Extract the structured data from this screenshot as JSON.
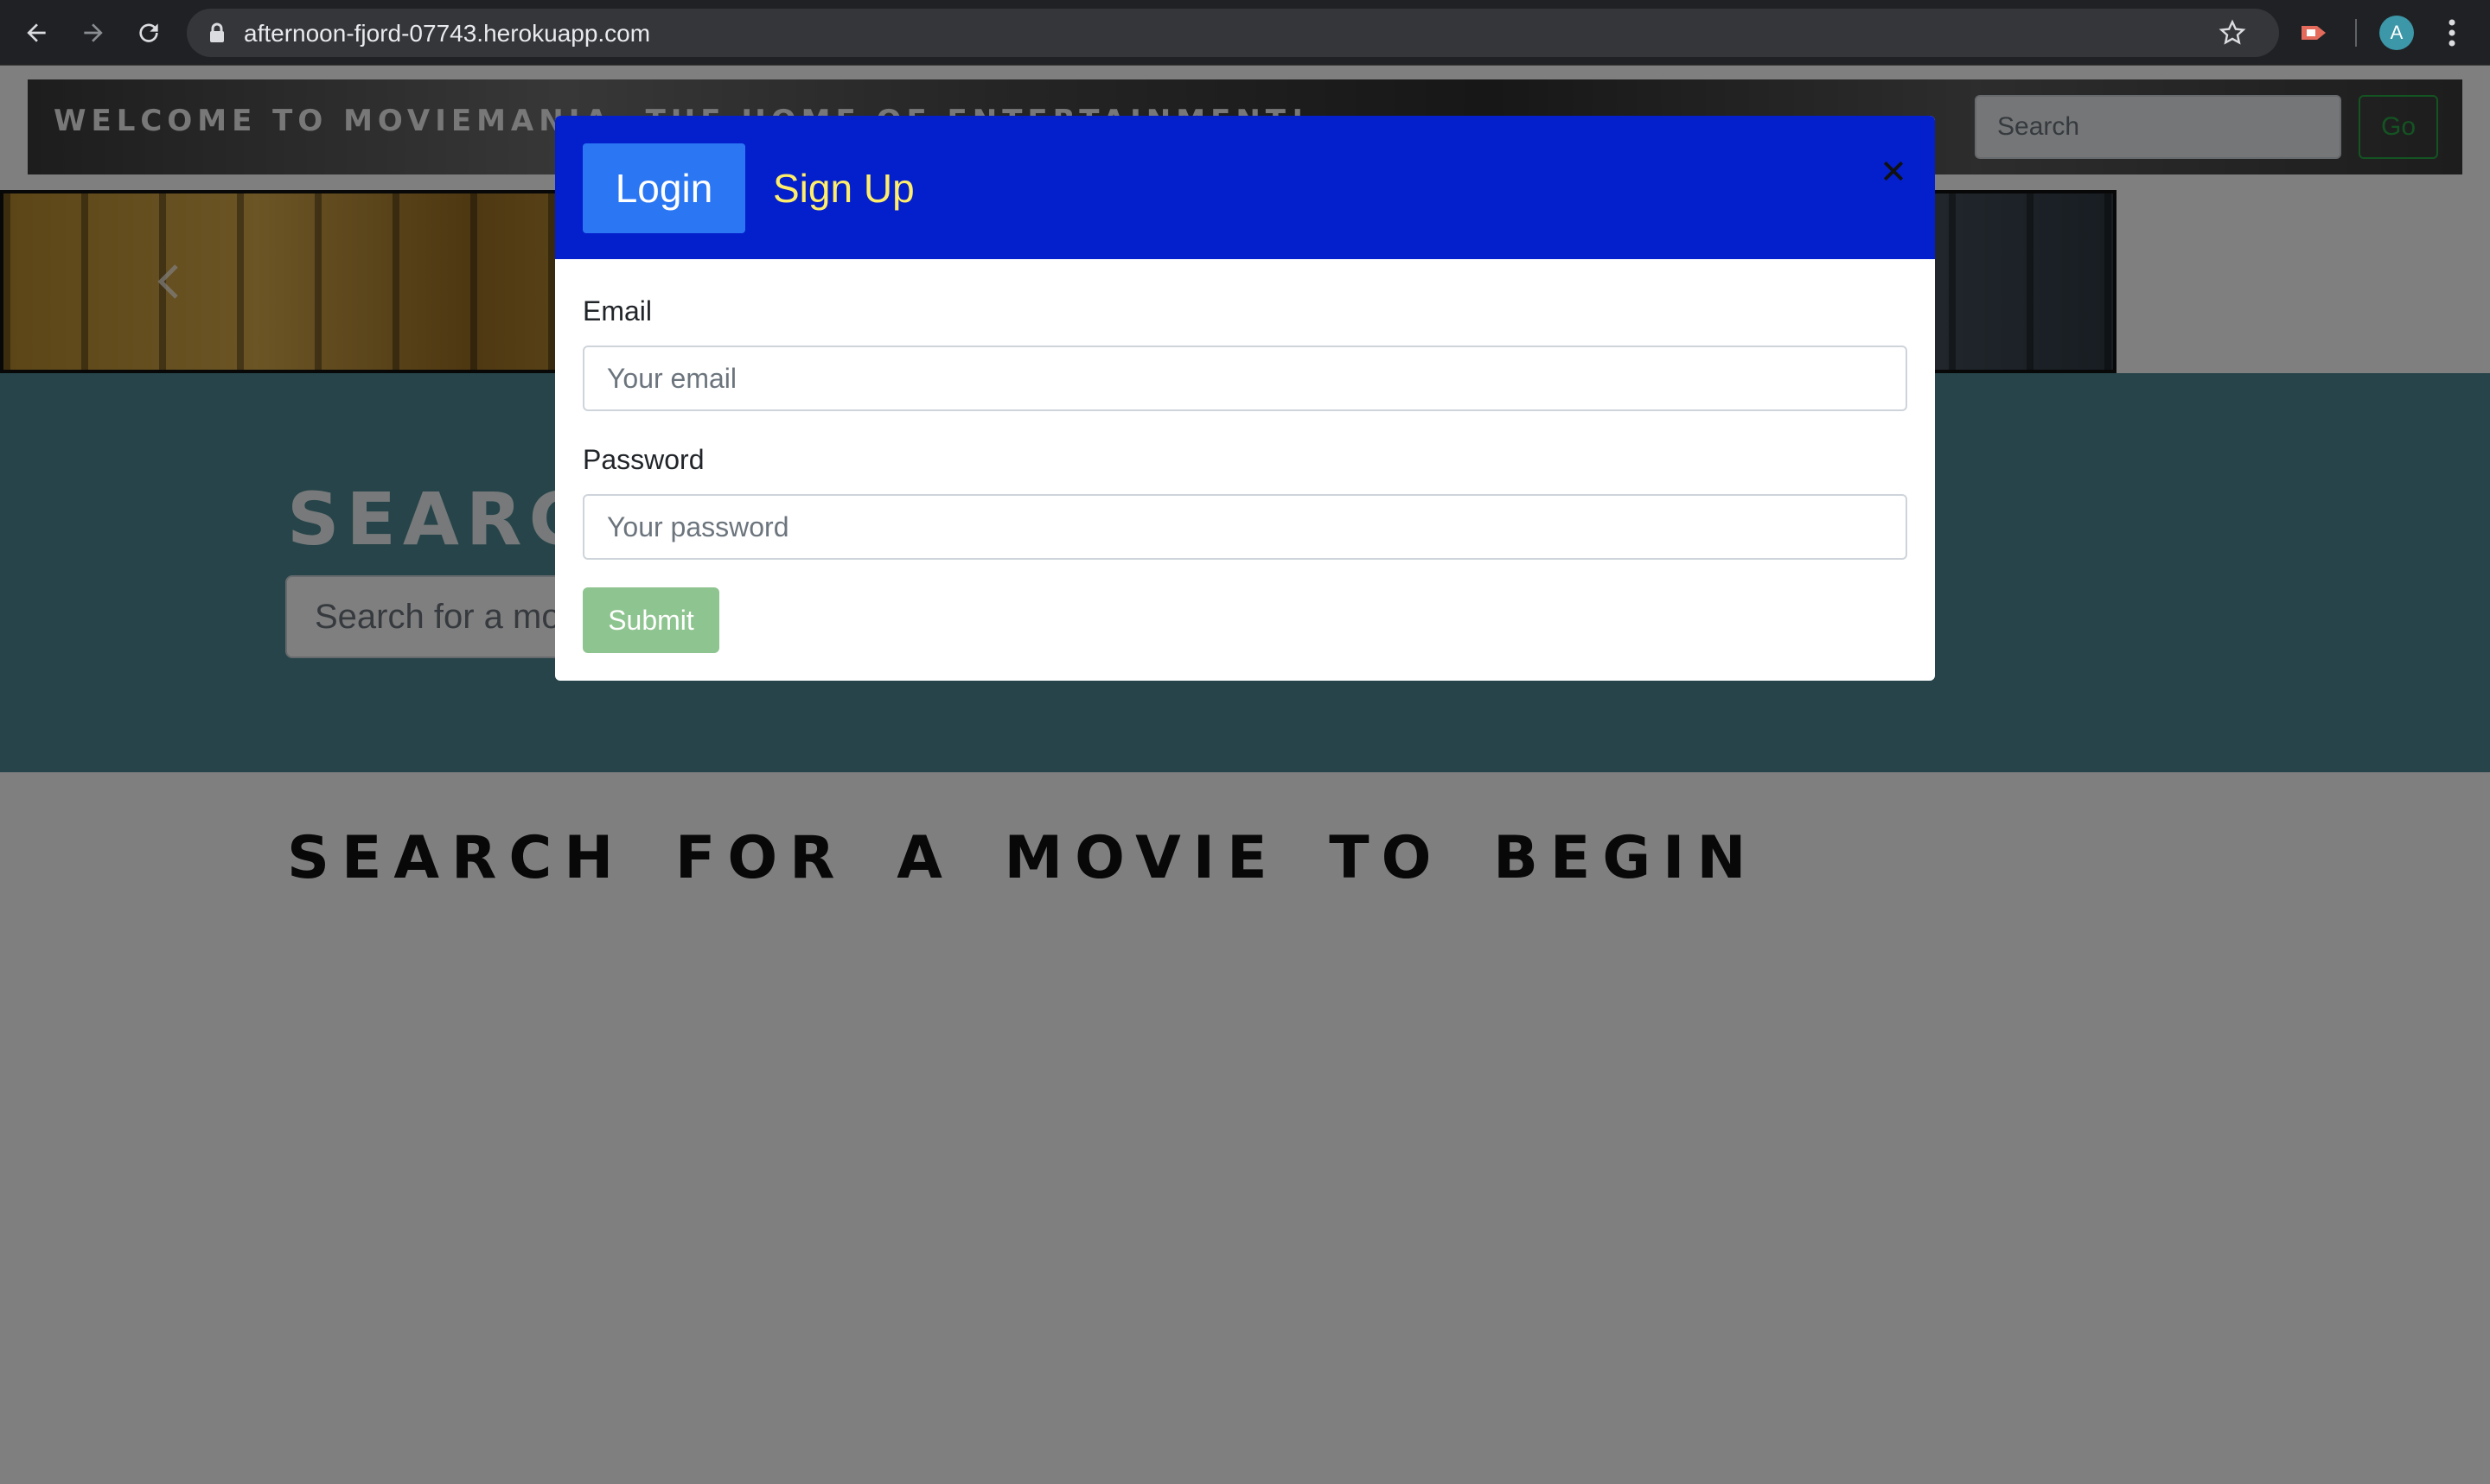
{
  "browser": {
    "url": "afternoon-fjord-07743.herokuapp.com",
    "profile_initial": "A"
  },
  "navbar": {
    "brand": "WELCOME TO MOVIEMANIA- THE HOME OF ENTERTAINMENT!",
    "search_placeholder": "Search",
    "go_label": "Go"
  },
  "hero": {
    "title": "SEARCH",
    "search_placeholder": "Search for a movie"
  },
  "results": {
    "heading": "SEARCH FOR A MOVIE TO BEGIN"
  },
  "modal": {
    "tabs": {
      "login": "Login",
      "signup": "Sign Up"
    },
    "email_label": "Email",
    "email_placeholder": "Your email",
    "password_label": "Password",
    "password_placeholder": "Your password",
    "submit_label": "Submit"
  },
  "colors": {
    "modal_header": "#041fcc",
    "login_tab": "#2b76f3",
    "signup_text": "#ffee6a",
    "submit": "#8ec48f",
    "hero_bg": "#4d8992"
  }
}
